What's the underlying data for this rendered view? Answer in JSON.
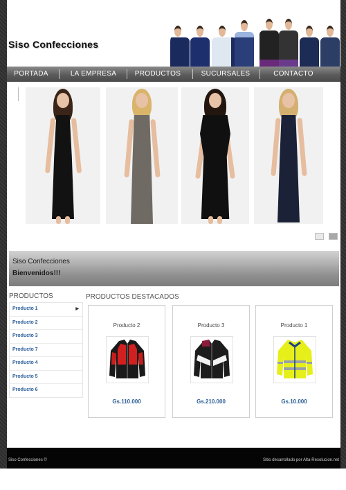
{
  "header": {
    "logo": "Siso Confecciones"
  },
  "nav": {
    "items": [
      "PORTADA",
      "LA EMPRESA",
      "PRODUCTOS",
      "SUCURSALES",
      "CONTACTO"
    ]
  },
  "welcome": {
    "title": "Siso Confecciones",
    "message": "Bienvenidos!!!"
  },
  "sidebar": {
    "title": "PRODUCTOS",
    "items": [
      "Producto 1",
      "Producto 2",
      "Producto 3",
      "Producto 7",
      "Producto 4",
      "Producto 5",
      "Producto 6"
    ]
  },
  "featured": {
    "title": "PRODUCTOS DESTACADOS",
    "cards": [
      {
        "name": "Producto 2",
        "price": "Gs.110.000",
        "icon": "red-black-jacket-icon"
      },
      {
        "name": "Producto 3",
        "price": "Gs.210.000",
        "icon": "black-white-jacket-icon"
      },
      {
        "name": "Producto 1",
        "price": "Gs.10.000",
        "icon": "hi-vis-yellow-jacket-icon"
      }
    ]
  },
  "footer": {
    "left": "Siso Confecciones ©",
    "right": "Sitio desarrollado por Alta-Resolucion.net"
  },
  "colors": {
    "link_blue": "#2d5f99",
    "nav_grey": "#5b5b5b",
    "footer_black": "#050505"
  }
}
